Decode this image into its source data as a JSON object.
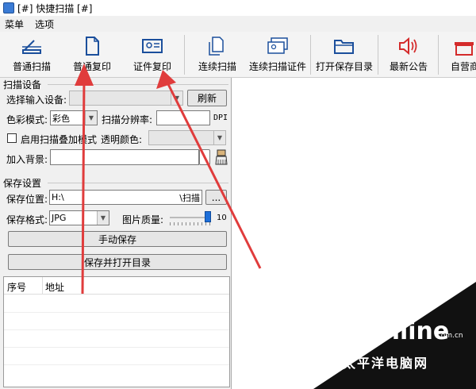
{
  "window": {
    "title": "[#] 快捷扫描 [#]"
  },
  "menu": {
    "items": [
      "菜单",
      "选项"
    ]
  },
  "toolbar": {
    "buttons": [
      "普通扫描",
      "普通复印",
      "证件复印",
      "连续扫描",
      "连续扫描证件",
      "打开保存目录",
      "最新公告",
      "自营商"
    ]
  },
  "scan_settings": {
    "title": "扫描设备",
    "device_label": "选择输入设备:",
    "device_value": "",
    "refresh": "刷新",
    "color_label": "色彩模式:",
    "color_value": "彩色",
    "resolution_label": "扫描分辨率:",
    "resolution_value": "",
    "resolution_unit": "DPI",
    "overlay_label": "启用扫描叠加模式",
    "overlay_checked": false,
    "transparent_label": "透明颜色:",
    "background_label": "加入背景:",
    "background_value": ""
  },
  "save_settings": {
    "title": "保存设置",
    "location_label": "保存位置:",
    "location_value": "H:\\",
    "location_suffix": "\\扫描",
    "browse": "...",
    "format_label": "保存格式:",
    "format_value": "JPG",
    "quality_label": "图片质量:",
    "quality_value": "10",
    "quality_level": 1.0,
    "manual_save": "手动保存",
    "save_open": "保存并打开目录"
  },
  "table": {
    "columns": [
      "序号",
      "地址"
    ]
  },
  "watermark": {
    "brand": "PConline",
    "domain": ".com.cn",
    "cn": "太平洋电脑网"
  },
  "colors": {
    "arrow": "#e03c3c",
    "slider": "#1e6fd9"
  }
}
